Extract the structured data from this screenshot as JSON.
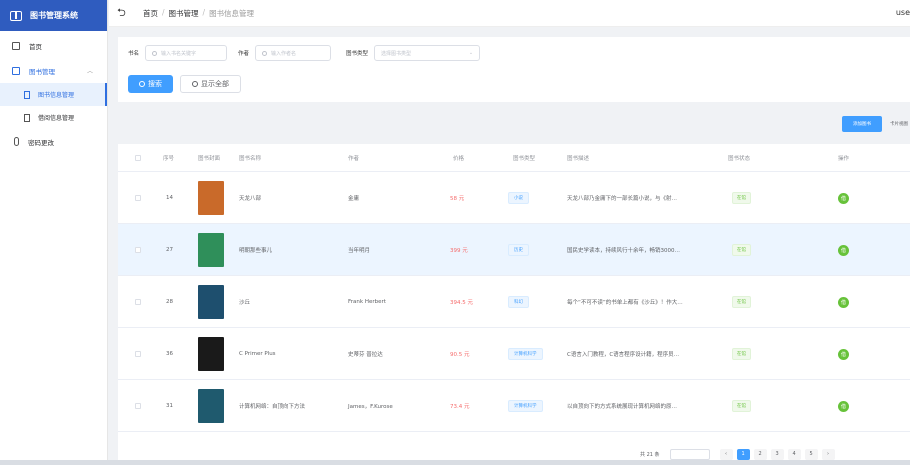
{
  "app": {
    "title": "图书管理系统",
    "user": "use"
  },
  "sidebar": {
    "items": [
      {
        "label": "首页"
      },
      {
        "label": "图书管理",
        "children": [
          {
            "label": "图书信息管理",
            "active": true
          },
          {
            "label": "借阅信息管理"
          }
        ]
      },
      {
        "label": "密码更改"
      }
    ]
  },
  "breadcrumb": [
    "首页",
    "图书管理",
    "图书信息管理"
  ],
  "search": {
    "name_label": "书名",
    "name_placeholder": "输入书名关键字",
    "author_label": "作者",
    "author_placeholder": "输入作者名",
    "type_label": "图书类型",
    "type_placeholder": "选择图书类型",
    "search_button": "搜索",
    "show_all_button": "显示全部"
  },
  "actions": {
    "batch": "添加图书",
    "extra": "卡片视图"
  },
  "table": {
    "columns": [
      "序号",
      "图书封面",
      "图书名称",
      "作者",
      "价格",
      "图书类型",
      "图书描述",
      "图书状态",
      "操作"
    ],
    "rows": [
      {
        "id": "14",
        "cover_color": "#c96a2a",
        "name": "天龙八部",
        "author": "金庸",
        "price": "58 元",
        "type": "小说",
        "desc": "天龙八部乃金庸下的一部长篇小说，与《射…",
        "status": "在馆",
        "op": "借"
      },
      {
        "id": "27",
        "cover_color": "#2f8f5a",
        "name": "明朝那些事儿",
        "author": "当年明月",
        "price": "399 元",
        "type": "历史",
        "desc": "国民史学读本，持续风行十余年，畅销3000…",
        "status": "在馆",
        "op": "借"
      },
      {
        "id": "28",
        "cover_color": "#1e4f6e",
        "name": "沙丘",
        "author": "Frank Herbert",
        "price": "394.5 元",
        "type": "科幻",
        "desc": "每个“不可不读”的书单上都有《沙丘》！作大…",
        "status": "在馆",
        "op": "借"
      },
      {
        "id": "36",
        "cover_color": "#1a1a1a",
        "name": "C Primer Plus",
        "author": "史蒂芬 普拉达",
        "price": "90.5 元",
        "type": "计算机科学",
        "desc": "C语言入门教程，C语言程序设计籍，程序员…",
        "status": "在馆",
        "op": "借"
      },
      {
        "id": "31",
        "cover_color": "#1f5a6e",
        "name": "计算机网络：自顶向下方法",
        "author": "James，F.Kurose",
        "price": "73.4 元",
        "type": "计算机科学",
        "desc": "以自顶向下的方式系统展现计算机网络的原…",
        "status": "在馆",
        "op": "借"
      }
    ]
  },
  "pager": {
    "total": "共 21 条",
    "pages": [
      "1",
      "2",
      "3",
      "4",
      "5"
    ],
    "current": "1"
  }
}
